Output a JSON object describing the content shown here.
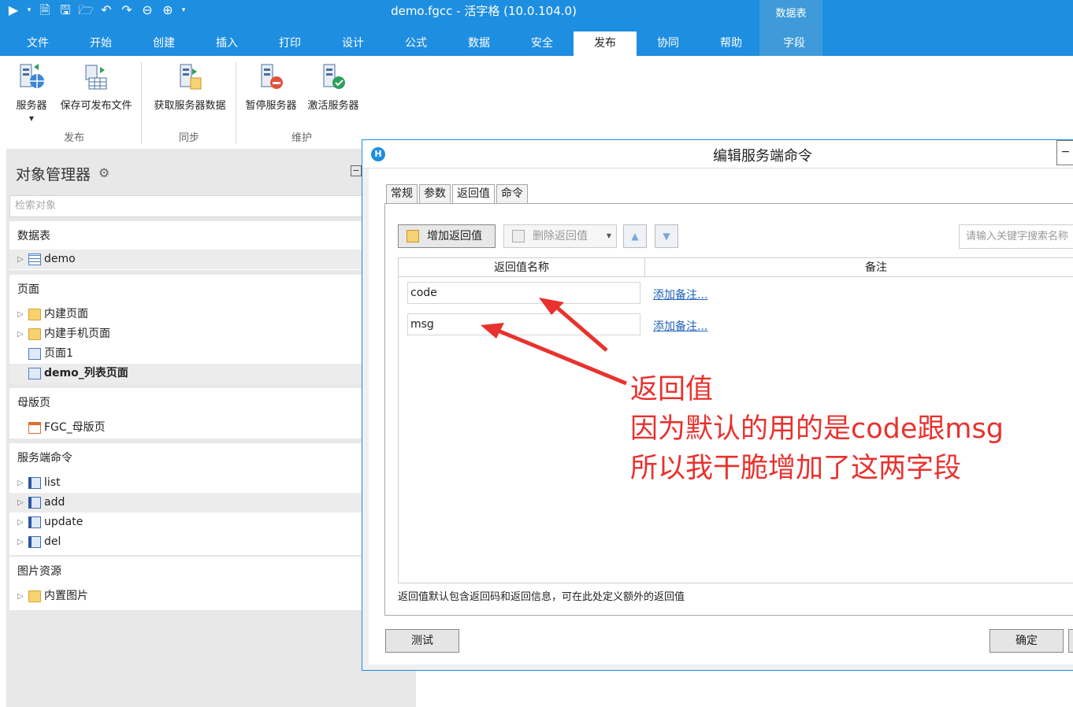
{
  "window": {
    "title": "demo.fgcc - 活字格 (10.0.104.0)",
    "context_group": "数据表"
  },
  "ribbon_tabs": [
    "文件",
    "开始",
    "创建",
    "插入",
    "打印",
    "设计",
    "公式",
    "数据",
    "安全",
    "发布",
    "协同",
    "帮助",
    "字段"
  ],
  "active_ribbon_tab": "发布",
  "ribbon": {
    "groups": [
      {
        "label": "发布",
        "buttons": [
          "服务器",
          "保存可发布文件"
        ]
      },
      {
        "label": "同步",
        "buttons": [
          "获取服务器数据"
        ]
      },
      {
        "label": "维护",
        "buttons": [
          "暂停服务器",
          "激活服务器"
        ]
      }
    ]
  },
  "object_manager": {
    "title": "对象管理器",
    "search_placeholder": "检索对象",
    "sections": [
      {
        "title": "数据表",
        "items": [
          "demo"
        ]
      },
      {
        "title": "页面",
        "items": [
          "内建页面",
          "内建手机页面",
          "页面1",
          "demo_列表页面"
        ]
      },
      {
        "title": "母版页",
        "items": [
          "FGC_母版页"
        ]
      },
      {
        "title": "服务端命令",
        "items": [
          "list",
          "add",
          "update",
          "del"
        ]
      },
      {
        "title": "图片资源",
        "items": [
          "内置图片"
        ]
      }
    ]
  },
  "dialog": {
    "title": "编辑服务端命令",
    "tabs": [
      "常规",
      "参数",
      "返回值",
      "命令"
    ],
    "active_tab": "返回值",
    "toolbar": {
      "add_label": "增加返回值",
      "delete_label": "删除返回值",
      "search_placeholder": "请输入关键字搜索名称"
    },
    "grid": {
      "columns": [
        "返回值名称",
        "备注"
      ],
      "rows": [
        {
          "name": "code",
          "note": "添加备注..."
        },
        {
          "name": "msg",
          "note": "添加备注..."
        }
      ]
    },
    "hint": "返回值默认包含返回码和返回信息，可在此处定义额外的返回值",
    "buttons": {
      "test": "测试",
      "ok": "确定"
    }
  },
  "annotation": {
    "color": "#e8322e",
    "lines": [
      "返回值",
      "因为默认的用的是code跟msg",
      "所以我干脆增加了这两字段"
    ]
  },
  "colors": {
    "accent": "#1e8ee0",
    "link": "#1f5fb7"
  }
}
